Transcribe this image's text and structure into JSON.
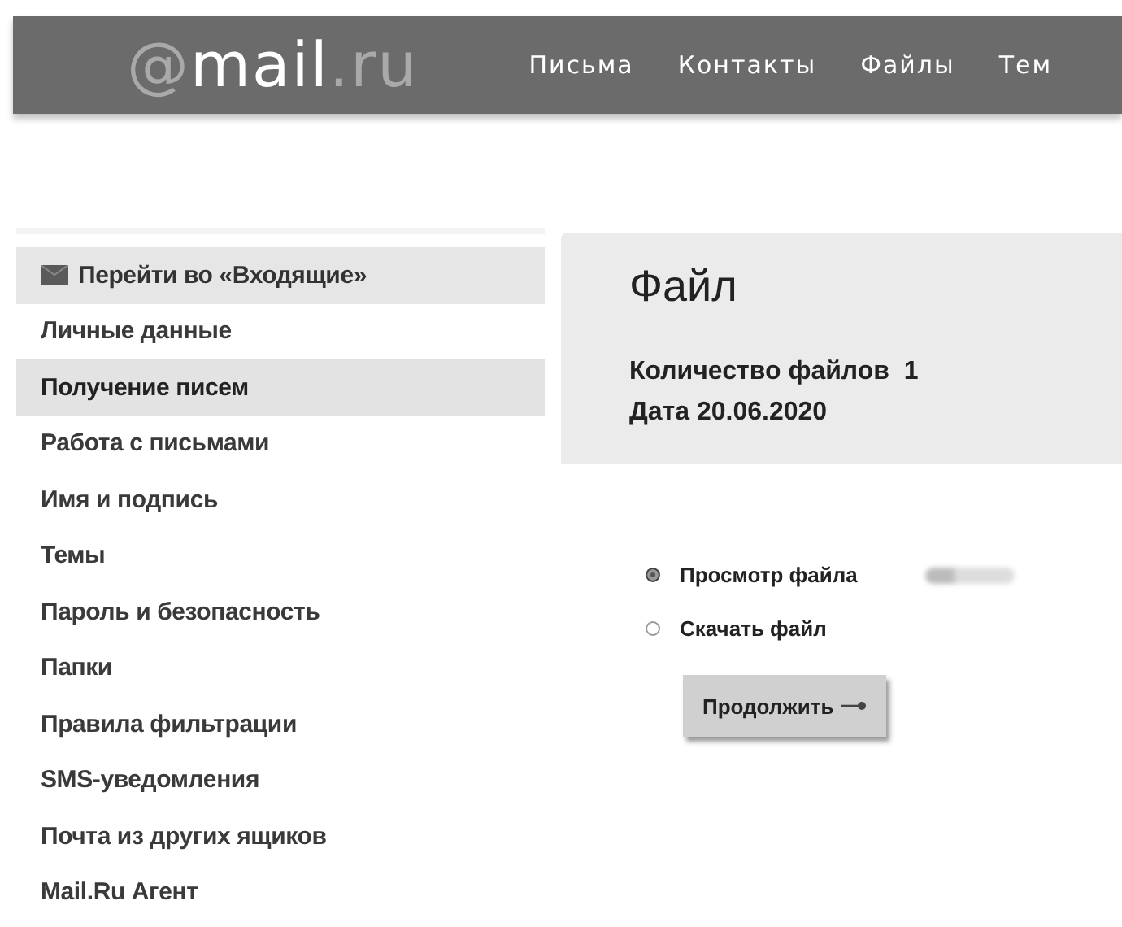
{
  "header": {
    "logo": [
      {
        "text": "@",
        "muted": true
      },
      {
        "text": "mail",
        "muted": false
      },
      {
        "text": ".ru",
        "muted": true
      }
    ],
    "nav": [
      {
        "label": "Письма"
      },
      {
        "label": "Контакты"
      },
      {
        "label": "Файлы"
      },
      {
        "label": "Тем"
      }
    ]
  },
  "sidebar": {
    "items": [
      {
        "label": "Перейти во «Входящие»",
        "kind": "inbox",
        "selected": false
      },
      {
        "label": "Личные данные",
        "kind": "link",
        "selected": false
      },
      {
        "label": "Получение писем",
        "kind": "link",
        "selected": true
      },
      {
        "label": "Работа с письмами",
        "kind": "link",
        "selected": false
      },
      {
        "label": "Имя и подпись",
        "kind": "link",
        "selected": false
      },
      {
        "label": "Темы",
        "kind": "link",
        "selected": false
      },
      {
        "label": "Пароль и безопасность",
        "kind": "link",
        "selected": false
      },
      {
        "label": "Папки",
        "kind": "link",
        "selected": false
      },
      {
        "label": "Правила фильтрации",
        "kind": "link",
        "selected": false
      },
      {
        "label": "SMS-уведомления",
        "kind": "link",
        "selected": false
      },
      {
        "label": "Почта из других ящиков",
        "kind": "link",
        "selected": false
      },
      {
        "label": "Mail.Ru Агент",
        "kind": "link",
        "selected": false
      }
    ]
  },
  "panel": {
    "title": "Файл",
    "info": [
      "Количество файлов  1",
      "Дата 20.06.2020"
    ],
    "options": [
      {
        "label": "Просмотр файла",
        "selected": true,
        "blurred_note": true
      },
      {
        "label": "Скачать файл",
        "selected": false,
        "blurred_note": false
      }
    ],
    "button": {
      "label": "Продолжить"
    }
  }
}
